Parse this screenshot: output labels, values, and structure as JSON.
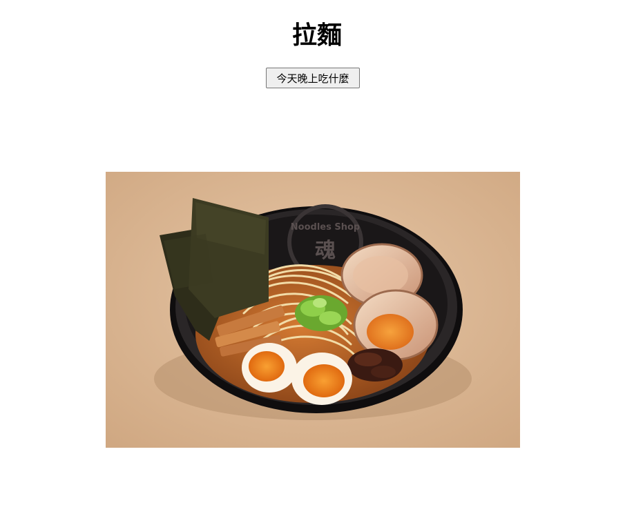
{
  "page": {
    "title": "拉麵",
    "button_label": "今天晚上吃什麼"
  },
  "image": {
    "subject": "ramen-bowl",
    "bowl_text": "Noodles Shop",
    "bowl_logo_text": "魂"
  },
  "colors": {
    "background": "#ffffff",
    "photo_background": "#dcb898",
    "bowl": "#1c1a1b",
    "broth": "#b8662a",
    "noodles": "#f2dca8",
    "egg_yolk": "#f08a1c",
    "nori": "#3c3b22",
    "scallion": "#7cbf3c"
  }
}
